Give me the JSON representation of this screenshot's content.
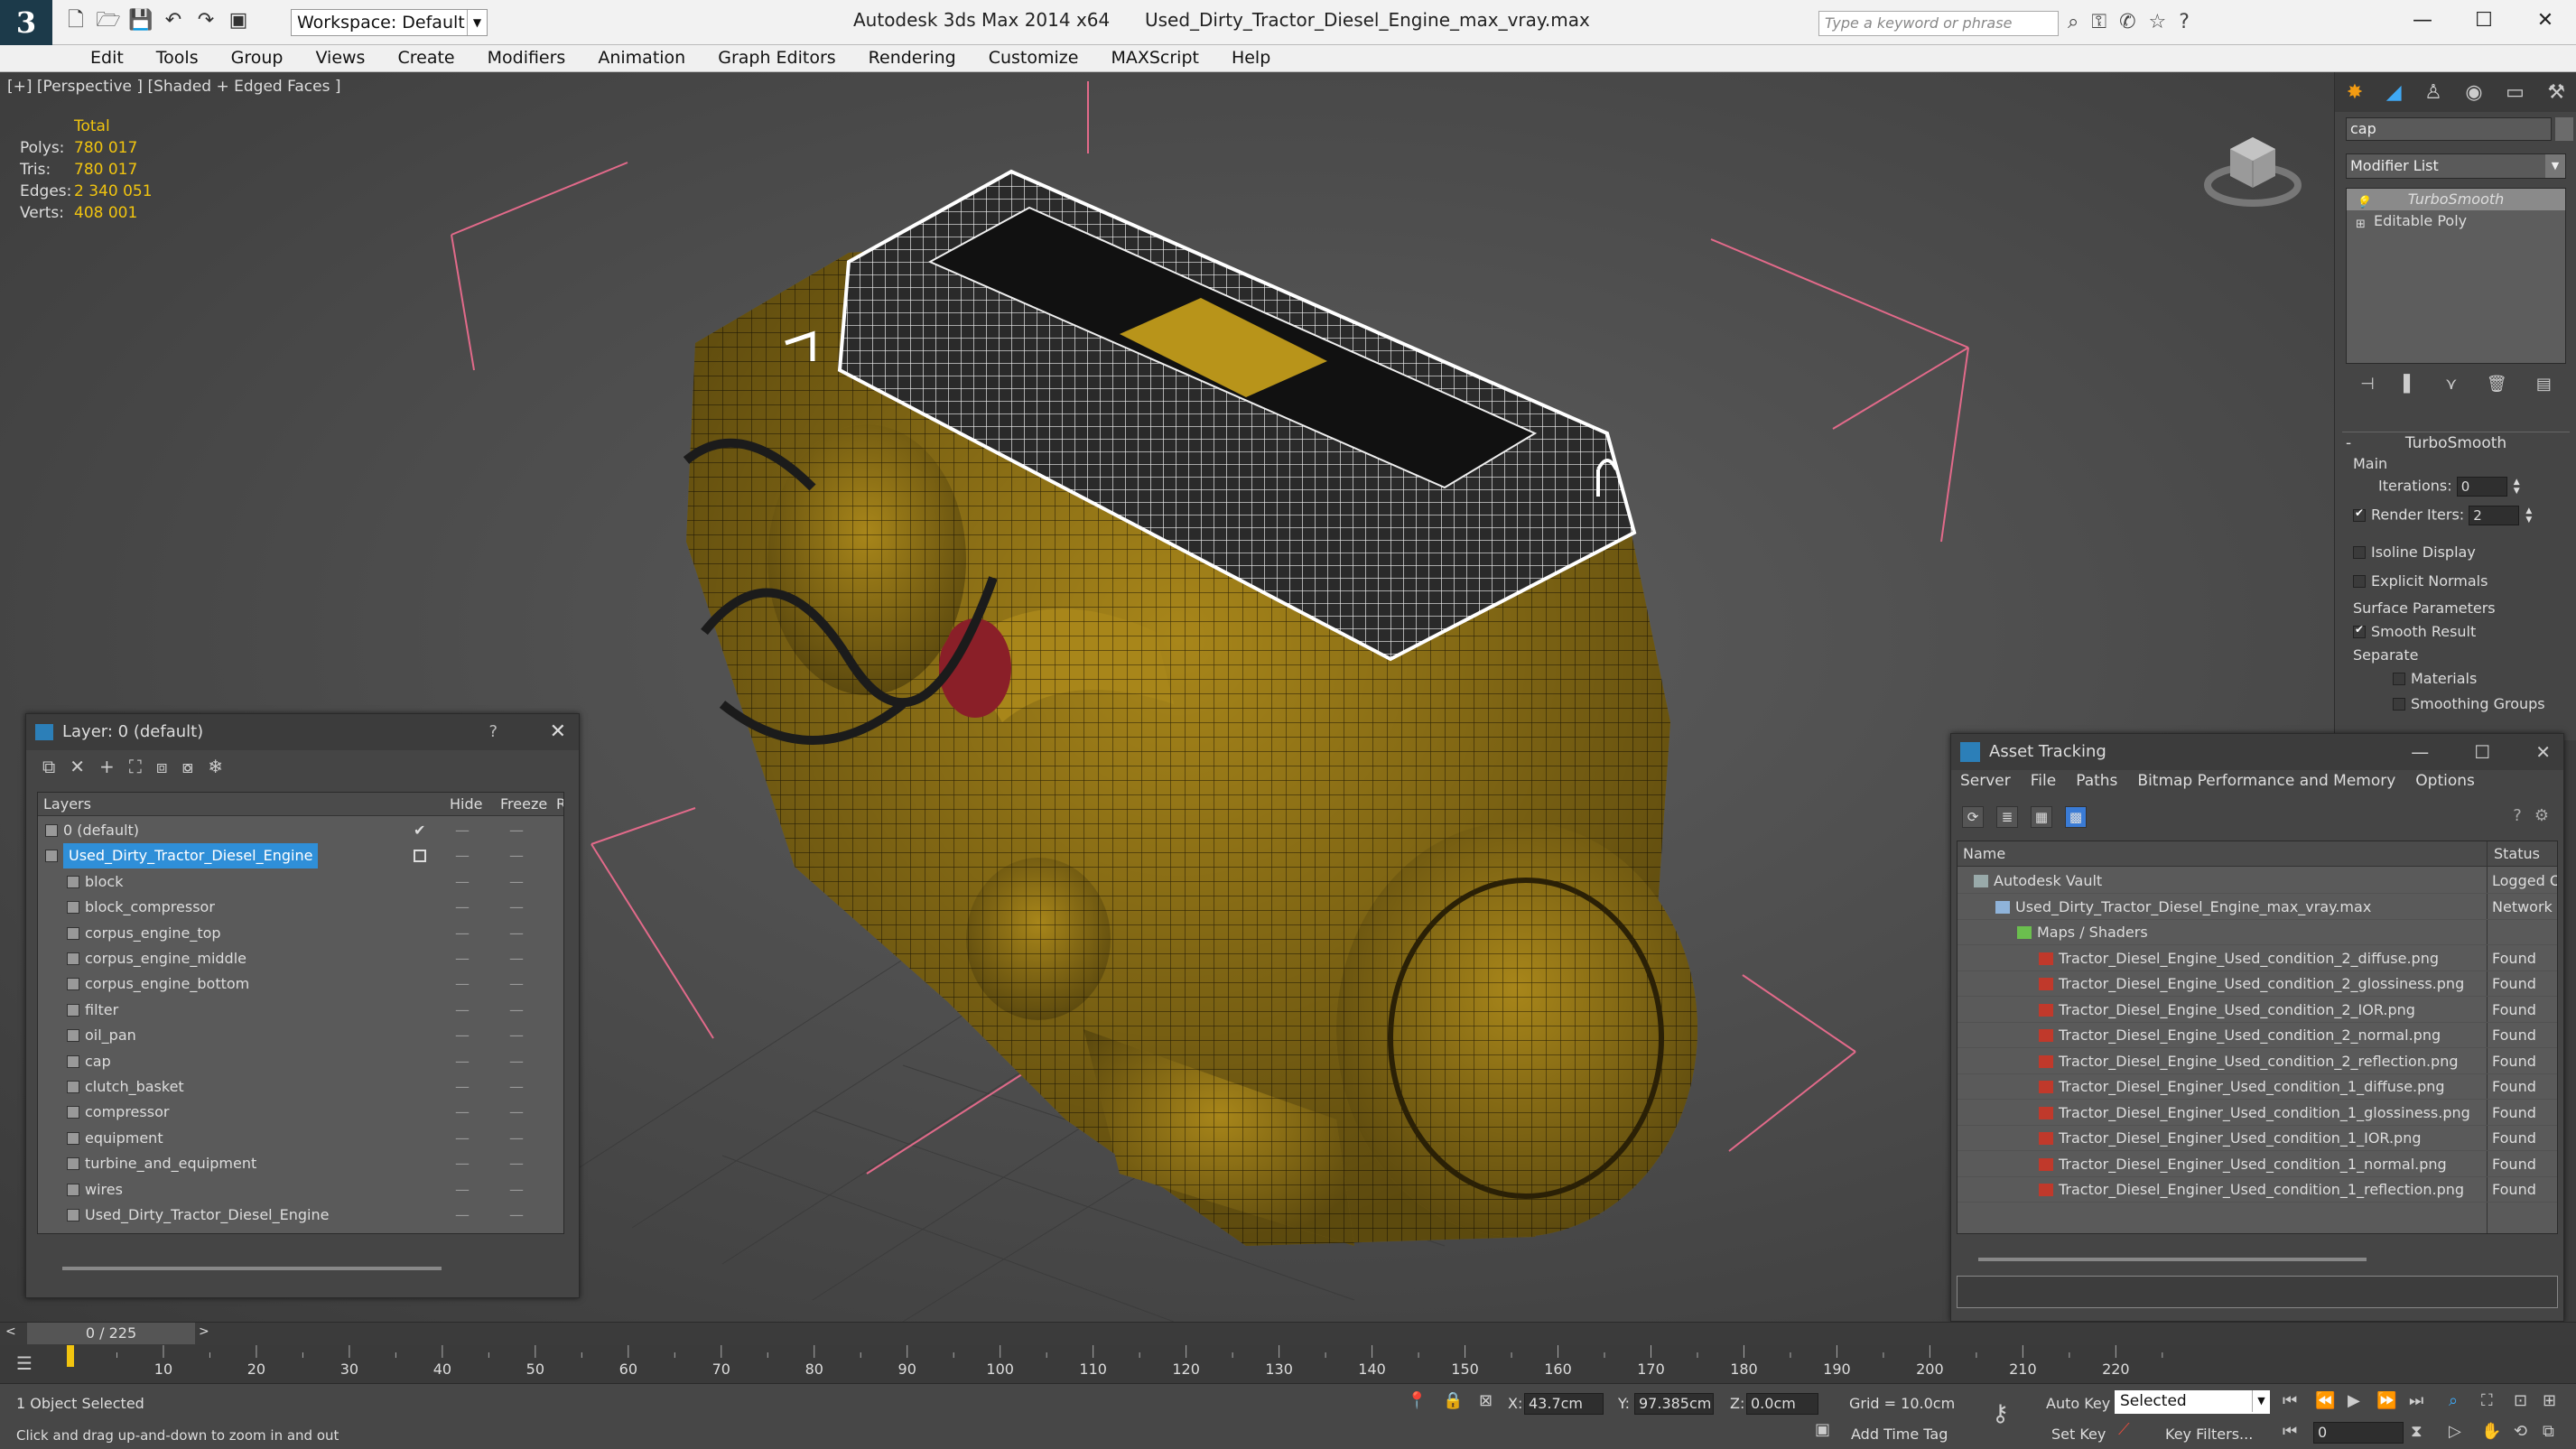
{
  "titlebar": {
    "app_title": "Autodesk 3ds Max  2014 x64",
    "file_title": "Used_Dirty_Tractor_Diesel_Engine_max_vray.max",
    "workspace": "Workspace: Default",
    "search_placeholder": "Type a keyword or phrase"
  },
  "menu": [
    "Edit",
    "Tools",
    "Group",
    "Views",
    "Create",
    "Modifiers",
    "Animation",
    "Graph Editors",
    "Rendering",
    "Customize",
    "MAXScript",
    "Help"
  ],
  "viewport": {
    "label": "[+] [Perspective ] [Shaded + Edged Faces ]",
    "stats": {
      "total_label": "Total",
      "rows": [
        {
          "label": "Polys:",
          "value": "780 017"
        },
        {
          "label": "Tris:",
          "value": "780 017"
        },
        {
          "label": "Edges:",
          "value": "2 340 051"
        },
        {
          "label": "Verts:",
          "value": "408 001"
        }
      ]
    }
  },
  "command_panel": {
    "object_name": "cap",
    "modifier_list_label": "Modifier List",
    "stack": [
      "TurboSmooth",
      "Editable Poly"
    ],
    "turbosmooth": {
      "title": "TurboSmooth",
      "main_label": "Main",
      "iterations_label": "Iterations:",
      "iterations_value": "0",
      "render_iters_label": "Render Iters:",
      "render_iters_value": "2",
      "render_iters_checked": true,
      "isoline_label": "Isoline Display",
      "explicit_normals_label": "Explicit Normals",
      "surface_params_label": "Surface Parameters",
      "smooth_result_label": "Smooth Result",
      "separate_label": "Separate",
      "materials_label": "Materials",
      "smoothing_groups_label": "Smoothing Groups"
    }
  },
  "layer_window": {
    "title": "Layer: 0 (default)",
    "help": "?",
    "columns": {
      "layers": "Layers",
      "hide": "Hide",
      "freeze": "Freeze",
      "render": "R"
    },
    "rows": [
      {
        "name": "0 (default)",
        "level": 0,
        "checked": true
      },
      {
        "name": "Used_Dirty_Tractor_Diesel_Engine",
        "level": 0,
        "selected": true
      },
      {
        "name": "block",
        "level": 1
      },
      {
        "name": "block_compressor",
        "level": 1
      },
      {
        "name": "corpus_engine_top",
        "level": 1
      },
      {
        "name": "corpus_engine_middle",
        "level": 1
      },
      {
        "name": "corpus_engine_bottom",
        "level": 1
      },
      {
        "name": "filter",
        "level": 1
      },
      {
        "name": "oil_pan",
        "level": 1
      },
      {
        "name": "cap",
        "level": 1
      },
      {
        "name": "clutch_basket",
        "level": 1
      },
      {
        "name": "compressor",
        "level": 1
      },
      {
        "name": "equipment",
        "level": 1
      },
      {
        "name": "turbine_and_equipment",
        "level": 1
      },
      {
        "name": "wires",
        "level": 1
      },
      {
        "name": "Used_Dirty_Tractor_Diesel_Engine",
        "level": 1
      }
    ],
    "dash": "—"
  },
  "asset_window": {
    "title": "Asset Tracking",
    "menu": [
      "Server",
      "File",
      "Paths",
      "Bitmap Performance and Memory",
      "Options"
    ],
    "columns": {
      "name": "Name",
      "status": "Status"
    },
    "rows": [
      {
        "name": "Autodesk Vault",
        "status": "Logged O",
        "icon": "vault",
        "level": 0
      },
      {
        "name": "Used_Dirty_Tractor_Diesel_Engine_max_vray.max",
        "status": "Network",
        "icon": "max",
        "level": 1
      },
      {
        "name": "Maps / Shaders",
        "status": "",
        "icon": "maps",
        "level": 2
      },
      {
        "name": "Tractor_Diesel_Engine_Used_condition_2_diffuse.png",
        "status": "Found",
        "icon": "png",
        "level": 3
      },
      {
        "name": "Tractor_Diesel_Engine_Used_condition_2_glossiness.png",
        "status": "Found",
        "icon": "png",
        "level": 3
      },
      {
        "name": "Tractor_Diesel_Engine_Used_condition_2_IOR.png",
        "status": "Found",
        "icon": "png",
        "level": 3
      },
      {
        "name": "Tractor_Diesel_Engine_Used_condition_2_normal.png",
        "status": "Found",
        "icon": "png",
        "level": 3
      },
      {
        "name": "Tractor_Diesel_Engine_Used_condition_2_reflection.png",
        "status": "Found",
        "icon": "png",
        "level": 3
      },
      {
        "name": "Tractor_Diesel_Enginer_Used_condition_1_diffuse.png",
        "status": "Found",
        "icon": "png",
        "level": 3
      },
      {
        "name": "Tractor_Diesel_Enginer_Used_condition_1_glossiness.png",
        "status": "Found",
        "icon": "png",
        "level": 3
      },
      {
        "name": "Tractor_Diesel_Enginer_Used_condition_1_IOR.png",
        "status": "Found",
        "icon": "png",
        "level": 3
      },
      {
        "name": "Tractor_Diesel_Enginer_Used_condition_1_normal.png",
        "status": "Found",
        "icon": "png",
        "level": 3
      },
      {
        "name": "Tractor_Diesel_Enginer_Used_condition_1_reflection.png",
        "status": "Found",
        "icon": "png",
        "level": 3
      }
    ]
  },
  "timeline": {
    "frame_label": "0 / 225",
    "ticks": [
      "10",
      "20",
      "30",
      "40",
      "50",
      "60",
      "70",
      "80",
      "90",
      "100",
      "110",
      "120",
      "130",
      "140",
      "150",
      "160",
      "170",
      "180",
      "190",
      "200",
      "210",
      "220"
    ]
  },
  "status": {
    "selection": "1 Object Selected",
    "prompt": "Click and drag up-and-down to zoom in and out",
    "x_label": "X:",
    "x_value": "43.7cm",
    "y_label": "Y:",
    "y_value": "97.385cm",
    "z_label": "Z:",
    "z_value": "0.0cm",
    "grid": "Grid = 10.0cm",
    "auto_key": "Auto Key",
    "set_key": "Set Key",
    "selected_mode": "Selected",
    "key_filters": "Key Filters...",
    "add_time_tag": "Add Time Tag",
    "frame_value": "0"
  },
  "colors": {
    "accent": "#2f8fd8",
    "stats": "#f1c40f",
    "engine": "#b8941a"
  }
}
